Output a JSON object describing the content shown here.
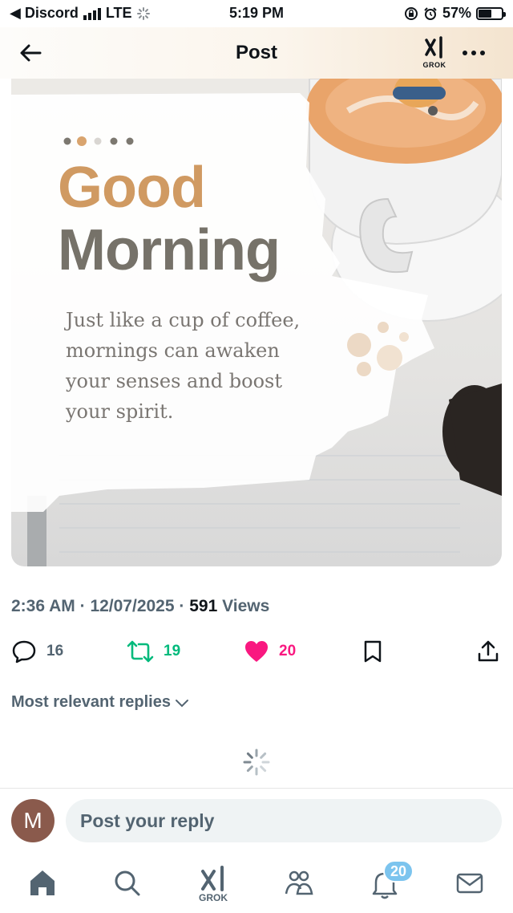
{
  "status_bar": {
    "back_app": "◀ Discord",
    "network": "LTE",
    "time": "5:19 PM",
    "battery": "57%",
    "battery_level": 0.57
  },
  "nav": {
    "title": "Post",
    "grok_label": "GROK",
    "icons": {
      "back": "arrow-left-icon",
      "grok": "grok-logo-icon",
      "more": "more-horizontal-icon"
    }
  },
  "post_image": {
    "headline_line1": "Good",
    "headline_line2": "Morning",
    "tagline": "Just like a cup of coffee,\nmornings can awaken\nyour senses and boost\nyour spirit.",
    "colors": {
      "headline_primary": "#d09a62",
      "headline_secondary": "#767269",
      "body_text": "#7a7672"
    }
  },
  "meta": {
    "time": "2:36 AM",
    "separator": "·",
    "date": "12/07/2025",
    "views_count": "591",
    "views_label": "Views"
  },
  "actions": {
    "reply_count": "16",
    "repost_count": "19",
    "like_count": "20",
    "liked": true,
    "colors": {
      "reply": "#536471",
      "repost": "#00ba7c",
      "like": "#f91880"
    }
  },
  "replies": {
    "sort_label": "Most relevant replies"
  },
  "reply_box": {
    "avatar_initial": "M",
    "placeholder": "Post your reply"
  },
  "tab_bar": {
    "items": [
      "home-icon",
      "search-icon",
      "grok-icon",
      "communities-icon",
      "notifications-icon",
      "messages-icon"
    ],
    "grok_label": "GROK",
    "notifications_badge": "20"
  }
}
